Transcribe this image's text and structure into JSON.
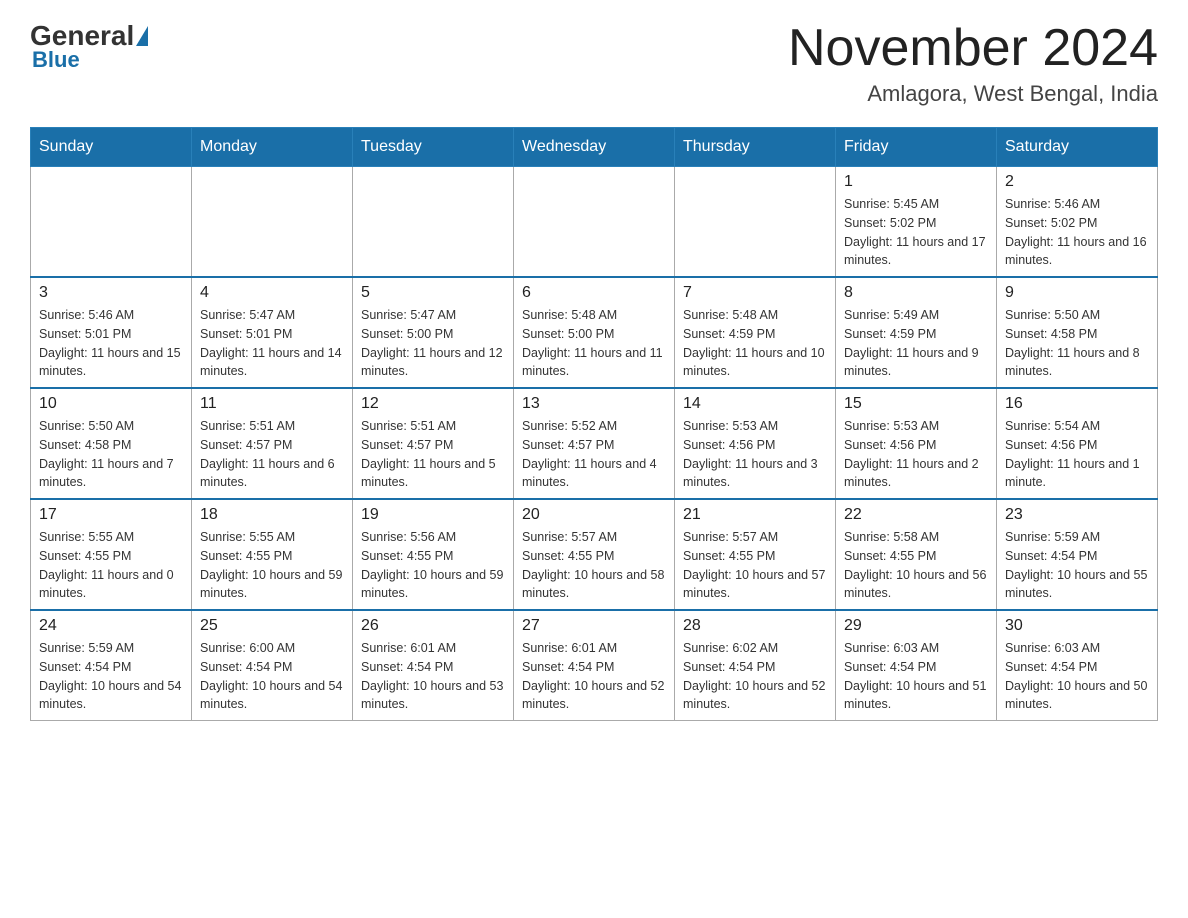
{
  "header": {
    "logo_general": "General",
    "logo_blue": "Blue",
    "month_title": "November 2024",
    "location": "Amlagora, West Bengal, India"
  },
  "days_of_week": [
    "Sunday",
    "Monday",
    "Tuesday",
    "Wednesday",
    "Thursday",
    "Friday",
    "Saturday"
  ],
  "weeks": [
    [
      {
        "day": "",
        "info": ""
      },
      {
        "day": "",
        "info": ""
      },
      {
        "day": "",
        "info": ""
      },
      {
        "day": "",
        "info": ""
      },
      {
        "day": "",
        "info": ""
      },
      {
        "day": "1",
        "info": "Sunrise: 5:45 AM\nSunset: 5:02 PM\nDaylight: 11 hours and 17 minutes."
      },
      {
        "day": "2",
        "info": "Sunrise: 5:46 AM\nSunset: 5:02 PM\nDaylight: 11 hours and 16 minutes."
      }
    ],
    [
      {
        "day": "3",
        "info": "Sunrise: 5:46 AM\nSunset: 5:01 PM\nDaylight: 11 hours and 15 minutes."
      },
      {
        "day": "4",
        "info": "Sunrise: 5:47 AM\nSunset: 5:01 PM\nDaylight: 11 hours and 14 minutes."
      },
      {
        "day": "5",
        "info": "Sunrise: 5:47 AM\nSunset: 5:00 PM\nDaylight: 11 hours and 12 minutes."
      },
      {
        "day": "6",
        "info": "Sunrise: 5:48 AM\nSunset: 5:00 PM\nDaylight: 11 hours and 11 minutes."
      },
      {
        "day": "7",
        "info": "Sunrise: 5:48 AM\nSunset: 4:59 PM\nDaylight: 11 hours and 10 minutes."
      },
      {
        "day": "8",
        "info": "Sunrise: 5:49 AM\nSunset: 4:59 PM\nDaylight: 11 hours and 9 minutes."
      },
      {
        "day": "9",
        "info": "Sunrise: 5:50 AM\nSunset: 4:58 PM\nDaylight: 11 hours and 8 minutes."
      }
    ],
    [
      {
        "day": "10",
        "info": "Sunrise: 5:50 AM\nSunset: 4:58 PM\nDaylight: 11 hours and 7 minutes."
      },
      {
        "day": "11",
        "info": "Sunrise: 5:51 AM\nSunset: 4:57 PM\nDaylight: 11 hours and 6 minutes."
      },
      {
        "day": "12",
        "info": "Sunrise: 5:51 AM\nSunset: 4:57 PM\nDaylight: 11 hours and 5 minutes."
      },
      {
        "day": "13",
        "info": "Sunrise: 5:52 AM\nSunset: 4:57 PM\nDaylight: 11 hours and 4 minutes."
      },
      {
        "day": "14",
        "info": "Sunrise: 5:53 AM\nSunset: 4:56 PM\nDaylight: 11 hours and 3 minutes."
      },
      {
        "day": "15",
        "info": "Sunrise: 5:53 AM\nSunset: 4:56 PM\nDaylight: 11 hours and 2 minutes."
      },
      {
        "day": "16",
        "info": "Sunrise: 5:54 AM\nSunset: 4:56 PM\nDaylight: 11 hours and 1 minute."
      }
    ],
    [
      {
        "day": "17",
        "info": "Sunrise: 5:55 AM\nSunset: 4:55 PM\nDaylight: 11 hours and 0 minutes."
      },
      {
        "day": "18",
        "info": "Sunrise: 5:55 AM\nSunset: 4:55 PM\nDaylight: 10 hours and 59 minutes."
      },
      {
        "day": "19",
        "info": "Sunrise: 5:56 AM\nSunset: 4:55 PM\nDaylight: 10 hours and 59 minutes."
      },
      {
        "day": "20",
        "info": "Sunrise: 5:57 AM\nSunset: 4:55 PM\nDaylight: 10 hours and 58 minutes."
      },
      {
        "day": "21",
        "info": "Sunrise: 5:57 AM\nSunset: 4:55 PM\nDaylight: 10 hours and 57 minutes."
      },
      {
        "day": "22",
        "info": "Sunrise: 5:58 AM\nSunset: 4:55 PM\nDaylight: 10 hours and 56 minutes."
      },
      {
        "day": "23",
        "info": "Sunrise: 5:59 AM\nSunset: 4:54 PM\nDaylight: 10 hours and 55 minutes."
      }
    ],
    [
      {
        "day": "24",
        "info": "Sunrise: 5:59 AM\nSunset: 4:54 PM\nDaylight: 10 hours and 54 minutes."
      },
      {
        "day": "25",
        "info": "Sunrise: 6:00 AM\nSunset: 4:54 PM\nDaylight: 10 hours and 54 minutes."
      },
      {
        "day": "26",
        "info": "Sunrise: 6:01 AM\nSunset: 4:54 PM\nDaylight: 10 hours and 53 minutes."
      },
      {
        "day": "27",
        "info": "Sunrise: 6:01 AM\nSunset: 4:54 PM\nDaylight: 10 hours and 52 minutes."
      },
      {
        "day": "28",
        "info": "Sunrise: 6:02 AM\nSunset: 4:54 PM\nDaylight: 10 hours and 52 minutes."
      },
      {
        "day": "29",
        "info": "Sunrise: 6:03 AM\nSunset: 4:54 PM\nDaylight: 10 hours and 51 minutes."
      },
      {
        "day": "30",
        "info": "Sunrise: 6:03 AM\nSunset: 4:54 PM\nDaylight: 10 hours and 50 minutes."
      }
    ]
  ]
}
